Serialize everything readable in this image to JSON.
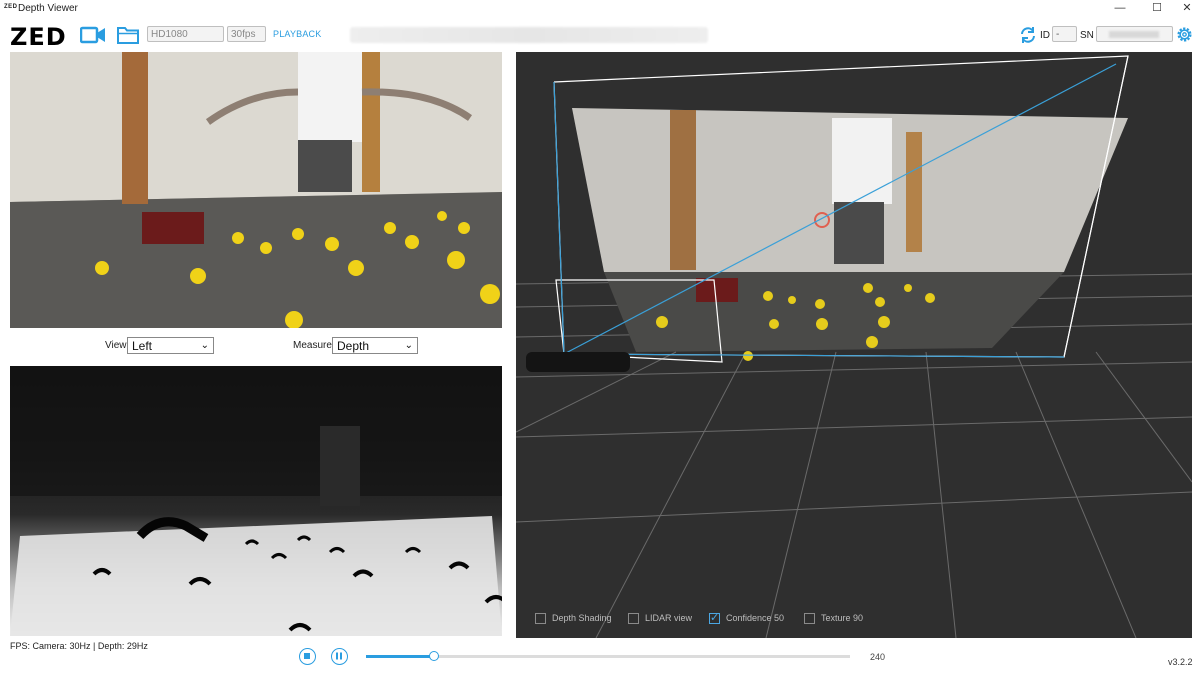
{
  "window": {
    "app_icon_text": "ZED",
    "title": "Depth Viewer",
    "minimize": "—",
    "maximize": "☐",
    "close": "✕"
  },
  "toolbar": {
    "logo": "ZED",
    "resolution": "HD1080",
    "fps": "30fps",
    "playback_label": "PLAYBACK",
    "id_label": "ID",
    "id_value": "-",
    "sn_label": "SN",
    "icons": [
      "video-camera-icon",
      "folder-icon",
      "refresh-icon",
      "gear-icon"
    ],
    "accent_color": "#2a9de0"
  },
  "view_selector": {
    "label": "View",
    "value": "Left"
  },
  "measure_selector": {
    "label": "Measure",
    "value": "Depth"
  },
  "viewer3d": {
    "checkboxes": [
      {
        "label": "Depth Shading",
        "checked": false
      },
      {
        "label": "LIDAR view",
        "checked": false
      },
      {
        "label": "Confidence 50",
        "checked": true
      },
      {
        "label": "Texture 90",
        "checked": false
      }
    ]
  },
  "status": {
    "fps_text": "FPS: Camera: 30Hz | Depth: 29Hz"
  },
  "playback": {
    "progress": 0.14,
    "frame_count": "240"
  },
  "version": "v3.2.2"
}
